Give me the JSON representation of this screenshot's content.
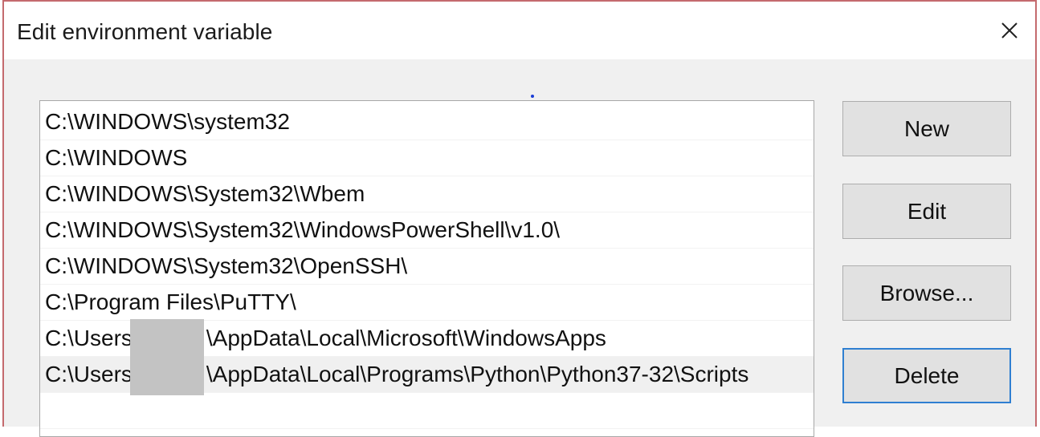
{
  "window": {
    "title": "Edit environment variable"
  },
  "path_list": {
    "items": [
      {
        "before": "C:\\WINDOWS\\system32",
        "after": "",
        "redacted": false,
        "selected": false
      },
      {
        "before": "C:\\WINDOWS",
        "after": "",
        "redacted": false,
        "selected": false
      },
      {
        "before": "C:\\WINDOWS\\System32\\Wbem",
        "after": "",
        "redacted": false,
        "selected": false
      },
      {
        "before": "C:\\WINDOWS\\System32\\WindowsPowerShell\\v1.0\\",
        "after": "",
        "redacted": false,
        "selected": false
      },
      {
        "before": "C:\\WINDOWS\\System32\\OpenSSH\\",
        "after": "",
        "redacted": false,
        "selected": false
      },
      {
        "before": "C:\\Program Files\\PuTTY\\",
        "after": "",
        "redacted": false,
        "selected": false
      },
      {
        "before": "C:\\Users",
        "after": "\\AppData\\Local\\Microsoft\\WindowsApps",
        "redacted": true,
        "selected": false
      },
      {
        "before": "C:\\Users",
        "after": "\\AppData\\Local\\Programs\\Python\\Python37-32\\Scripts",
        "redacted": true,
        "selected": true
      },
      {
        "before": "",
        "after": "",
        "redacted": false,
        "selected": false
      }
    ]
  },
  "buttons": {
    "new": "New",
    "edit": "Edit",
    "browse": "Browse...",
    "delete": "Delete"
  },
  "icons": {
    "close": "close-icon"
  },
  "colors": {
    "window_border": "#c46a6e",
    "default_button_border": "#2f7fd1",
    "selected_row": "#f0f0f0"
  }
}
